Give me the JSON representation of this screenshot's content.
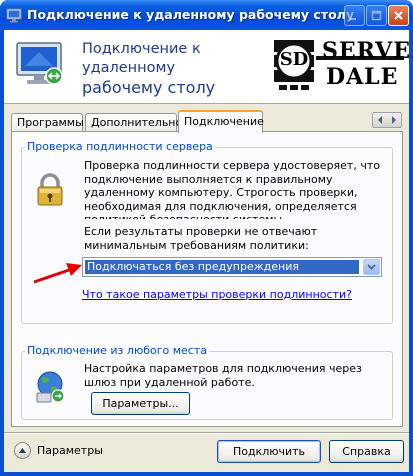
{
  "window": {
    "title": "Подключение к удаленному рабочему столу"
  },
  "banner": {
    "title_line1": "Подключение к удаленному",
    "title_line2": "рабочему столу",
    "logo_text_line1": "SERVER",
    "logo_text_line2": "DALE",
    "logo_badge": "SD"
  },
  "tabs": [
    {
      "label": "Программы"
    },
    {
      "label": "Дополнительно"
    },
    {
      "label": "Подключение",
      "selected": true
    }
  ],
  "auth_group": {
    "legend": "Проверка подлинности сервера",
    "description": "Проверка подлинности сервера удостоверяет, что подключение выполняется к правильному удаленному компьютеру. Строгость проверки, необходимая для подключения, определяется политикой безопасности системы.",
    "policy_label": "Если результаты проверки не отвечают минимальным требованиям политики:",
    "policy_select_value": "Подключаться без предупреждения",
    "help_link": "Что такое параметры проверки подлинности?"
  },
  "anywhere_group": {
    "legend": "Подключение из любого места",
    "description": "Настройка параметров для подключения через шлюз при удаленной работе.",
    "settings_button": "Параметры..."
  },
  "footer": {
    "options_label": "Параметры",
    "connect_button": "Подключить",
    "help_button": "Справка"
  },
  "colors": {
    "titlebar": "#0a57e5",
    "client_background": "#ece9d8",
    "tab_active_accent": "#f5a623",
    "legend_text": "#0046d5",
    "selection": "#316ac5",
    "link": "#0000ff",
    "annotation_arrow": "#e00000"
  },
  "icons": {
    "title": "remote-desktop-icon",
    "banner": "remote-desktop-monitor-icon",
    "auth": "padlock-icon",
    "anywhere": "globe-network-icon"
  }
}
